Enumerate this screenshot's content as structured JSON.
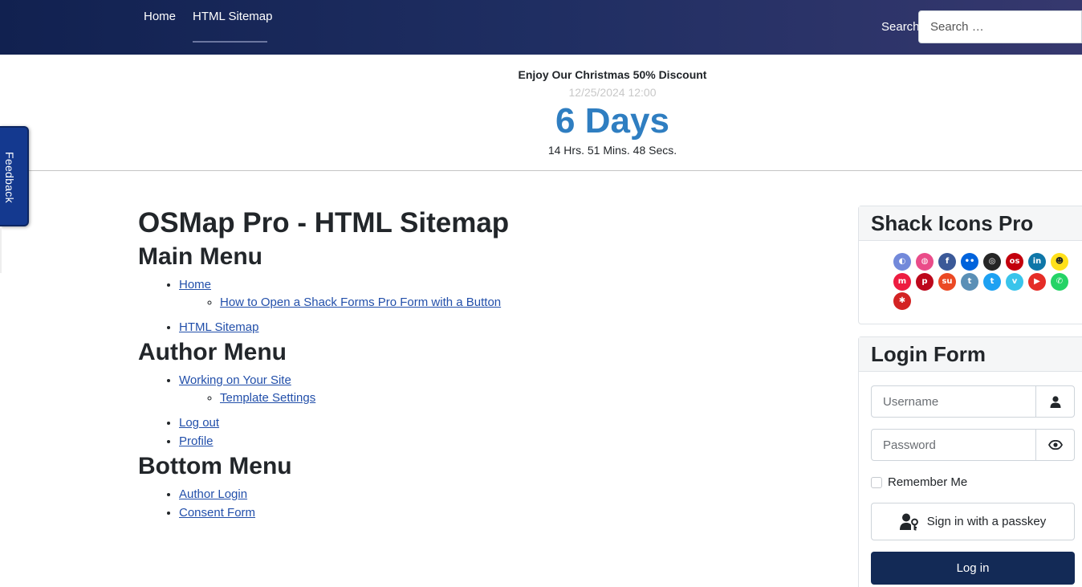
{
  "nav": {
    "items": [
      {
        "label": "Home"
      },
      {
        "label": "HTML Sitemap"
      }
    ],
    "search_label": "Search",
    "search_placeholder": "Search …"
  },
  "countdown": {
    "title": "Enjoy Our Christmas 50% Discount",
    "date": "12/25/2024 12:00",
    "days": "6 Days",
    "rest": "14 Hrs. 51 Mins. 48 Secs."
  },
  "feedback": {
    "label": "Feedback"
  },
  "main": {
    "title": "OSMap Pro - HTML Sitemap",
    "menus": [
      {
        "heading": "Main Menu",
        "items": [
          {
            "label": "Home",
            "children": [
              "How to Open a Shack Forms Pro Form with a Button"
            ]
          },
          {
            "label": "HTML Sitemap",
            "children": []
          }
        ]
      },
      {
        "heading": "Author Menu",
        "items": [
          {
            "label": "Working on Your Site",
            "children": [
              "Template Settings"
            ]
          },
          {
            "label": "Log out",
            "children": []
          },
          {
            "label": "Profile",
            "children": []
          }
        ]
      },
      {
        "heading": "Bottom Menu",
        "items": [
          {
            "label": "Author Login",
            "children": []
          },
          {
            "label": "Consent Form",
            "children": []
          }
        ]
      }
    ]
  },
  "sidebar": {
    "icons_title": "Shack Icons Pro",
    "icons": [
      {
        "name": "discord-icon",
        "color": "#7289da",
        "glyph": "◐"
      },
      {
        "name": "dribbble-icon",
        "color": "#ea4c89",
        "glyph": "◍"
      },
      {
        "name": "facebook-icon",
        "color": "#3b5998",
        "glyph": "f"
      },
      {
        "name": "flickr-icon",
        "color": "#0063dc",
        "glyph": "••"
      },
      {
        "name": "instagram-icon",
        "color": "#262626",
        "glyph": "◎"
      },
      {
        "name": "lastfm-icon",
        "color": "#c3000d",
        "glyph": "os"
      },
      {
        "name": "linkedin-icon",
        "color": "#0e76a8",
        "glyph": "in"
      },
      {
        "name": "mailchimp-icon",
        "color": "#ffe01b",
        "glyph": "☻"
      },
      {
        "name": "meetup-icon",
        "color": "#ed1c40",
        "glyph": "m"
      },
      {
        "name": "pinterest-icon",
        "color": "#bd081c",
        "glyph": "p"
      },
      {
        "name": "stumbleupon-icon",
        "color": "#eb4924",
        "glyph": "su"
      },
      {
        "name": "tumblr-icon",
        "color": "#5a8fb6",
        "glyph": "t"
      },
      {
        "name": "twitter-icon",
        "color": "#1da1f2",
        "glyph": "t"
      },
      {
        "name": "vimeo-icon",
        "color": "#39c4eb",
        "glyph": "v"
      },
      {
        "name": "youtube-icon",
        "color": "#e52d27",
        "glyph": "▶"
      },
      {
        "name": "whatsapp-icon",
        "color": "#25d366",
        "glyph": "✆"
      },
      {
        "name": "yelp-icon",
        "color": "#d32323",
        "glyph": "✱"
      }
    ],
    "login_title": "Login Form",
    "username_placeholder": "Username",
    "password_placeholder": "Password",
    "remember_label": "Remember Me",
    "passkey_label": "Sign in with a passkey",
    "login_label": "Log in"
  }
}
